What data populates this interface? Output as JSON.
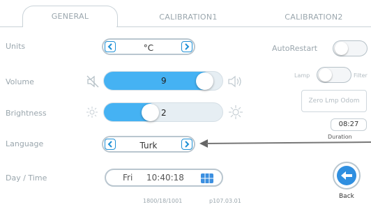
{
  "tabs": [
    {
      "label": "GENERAL",
      "active": true
    },
    {
      "label": "CALIBRATION1",
      "active": false
    },
    {
      "label": "CALIBRATION2",
      "active": false
    }
  ],
  "settings": {
    "units": {
      "label": "Units",
      "value": "°C"
    },
    "volume": {
      "label": "Volume",
      "value": "9",
      "level_fraction": 0.9
    },
    "brightness": {
      "label": "Brightness",
      "value": "2",
      "level_fraction": 0.45
    },
    "language": {
      "label": "Language",
      "value": "Turk"
    },
    "datetime": {
      "label": "Day / Time",
      "day": "Fri",
      "time": "10:40:18"
    }
  },
  "right_panel": {
    "autorestart_label": "AutoRestart",
    "lamp_label": "Lamp",
    "filter_label": "Filter",
    "zero_button": "Zero Lmp Odom",
    "duration_value": "08:27",
    "duration_label": "Duration",
    "back_label": "Back"
  },
  "footer": {
    "left": "1800/18/1001",
    "right": "p107.03.01"
  },
  "colors": {
    "accent": "#45b2f3",
    "arrow": "#1e90d6",
    "label_gray": "#9aa6ad"
  },
  "icons": {
    "mute": "speaker-mute-icon",
    "volume": "speaker-icon",
    "sun_small": "sun-dim-icon",
    "sun_large": "sun-bright-icon",
    "calendar": "calendar-icon",
    "back": "back-arrow-icon"
  }
}
